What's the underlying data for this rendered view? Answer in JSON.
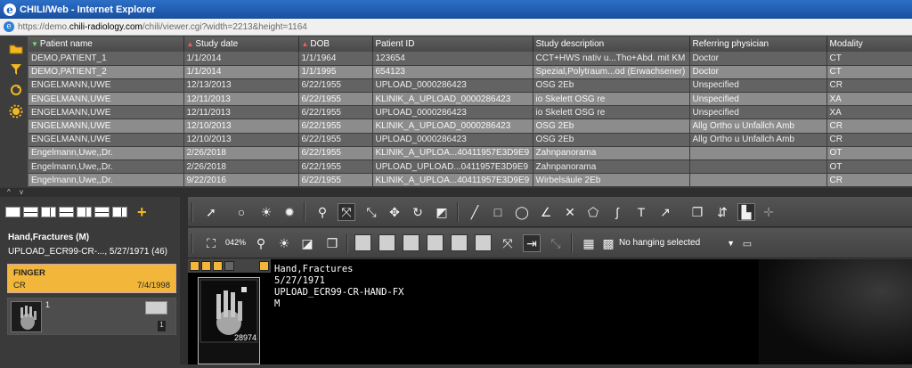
{
  "window": {
    "title": "CHILI/Web - Internet Explorer"
  },
  "address": {
    "prefix": "https://demo.",
    "domain": "chili-radiology.com",
    "path": "/chili/viewer.cgi?width=2213&height=1164"
  },
  "grid": {
    "columns": [
      "Patient name",
      "Study date",
      "DOB",
      "Patient ID",
      "Study description",
      "Referring physician",
      "Modality"
    ],
    "rows": [
      [
        "DEMO,PATIENT_1",
        "1/1/2014",
        "1/1/1964",
        "123654",
        "CCT+HWS nativ u...Tho+Abd. mit KM",
        "Doctor",
        "CT"
      ],
      [
        "DEMO,PATIENT_2",
        "1/1/2014",
        "1/1/1995",
        "654123",
        "Spezial,Polytraum...od (Erwachsener)",
        "Doctor",
        "CT"
      ],
      [
        "ENGELMANN,UWE",
        "12/13/2013",
        "6/22/1955",
        "UPLOAD_0000286423",
        "OSG 2Eb",
        "Unspecified",
        "CR"
      ],
      [
        "ENGELMANN,UWE",
        "12/11/2013",
        "6/22/1955",
        "KLINIK_A_UPLOAD_0000286423",
        "io Skelett OSG re",
        "Unspecified",
        "XA"
      ],
      [
        "ENGELMANN,UWE",
        "12/11/2013",
        "6/22/1955",
        "UPLOAD_0000286423",
        "io Skelett OSG re",
        "Unspecified",
        "XA"
      ],
      [
        "ENGELMANN,UWE",
        "12/10/2013",
        "6/22/1955",
        "KLINIK_A_UPLOAD_0000286423",
        "OSG 2Eb",
        "Allg Ortho u Unfallch Amb",
        "CR"
      ],
      [
        "ENGELMANN,UWE",
        "12/10/2013",
        "6/22/1955",
        "UPLOAD_0000286423",
        "OSG 2Eb",
        "Allg Ortho u Unfallch Amb",
        "CR"
      ],
      [
        "Engelmann,Uwe,,Dr.",
        "2/26/2018",
        "6/22/1955",
        "KLINIK_A_UPLOA...40411957E3D9E9",
        "Zahnpanorama",
        "",
        "OT"
      ],
      [
        "Engelmann,Uwe,,Dr.",
        "2/26/2018",
        "6/22/1955",
        "UPLOAD_UPLOAD...0411957E3D9E9",
        "Zahnpanorama",
        "",
        "OT"
      ],
      [
        "Engelmann,Uwe,,Dr.",
        "9/22/2016",
        "6/22/1955",
        "KLINIK_A_UPLOA...40411957E3D9E9",
        "Wirbelsäule 2Eb",
        "",
        "CR"
      ]
    ]
  },
  "splitter": {
    "label": "^ v"
  },
  "layout": {
    "plus": "+"
  },
  "patient": {
    "name": "Hand,Fractures (M)",
    "detail": "UPLOAD_ECR99-CR-..., 5/27/1971 (46)"
  },
  "study": {
    "title": "FINGER",
    "modality": "CR",
    "date": "7/4/1998"
  },
  "series": {
    "number": "1",
    "count": "1"
  },
  "toolbar": {
    "zoom": "042%",
    "hanging": "No hanging selected"
  },
  "viewer": {
    "line1": "Hand,Fractures",
    "line2": "5/27/1971",
    "line3": "UPLOAD_ECR99-CR-HAND-FX",
    "line4": "M",
    "thumb_count": "28974"
  }
}
